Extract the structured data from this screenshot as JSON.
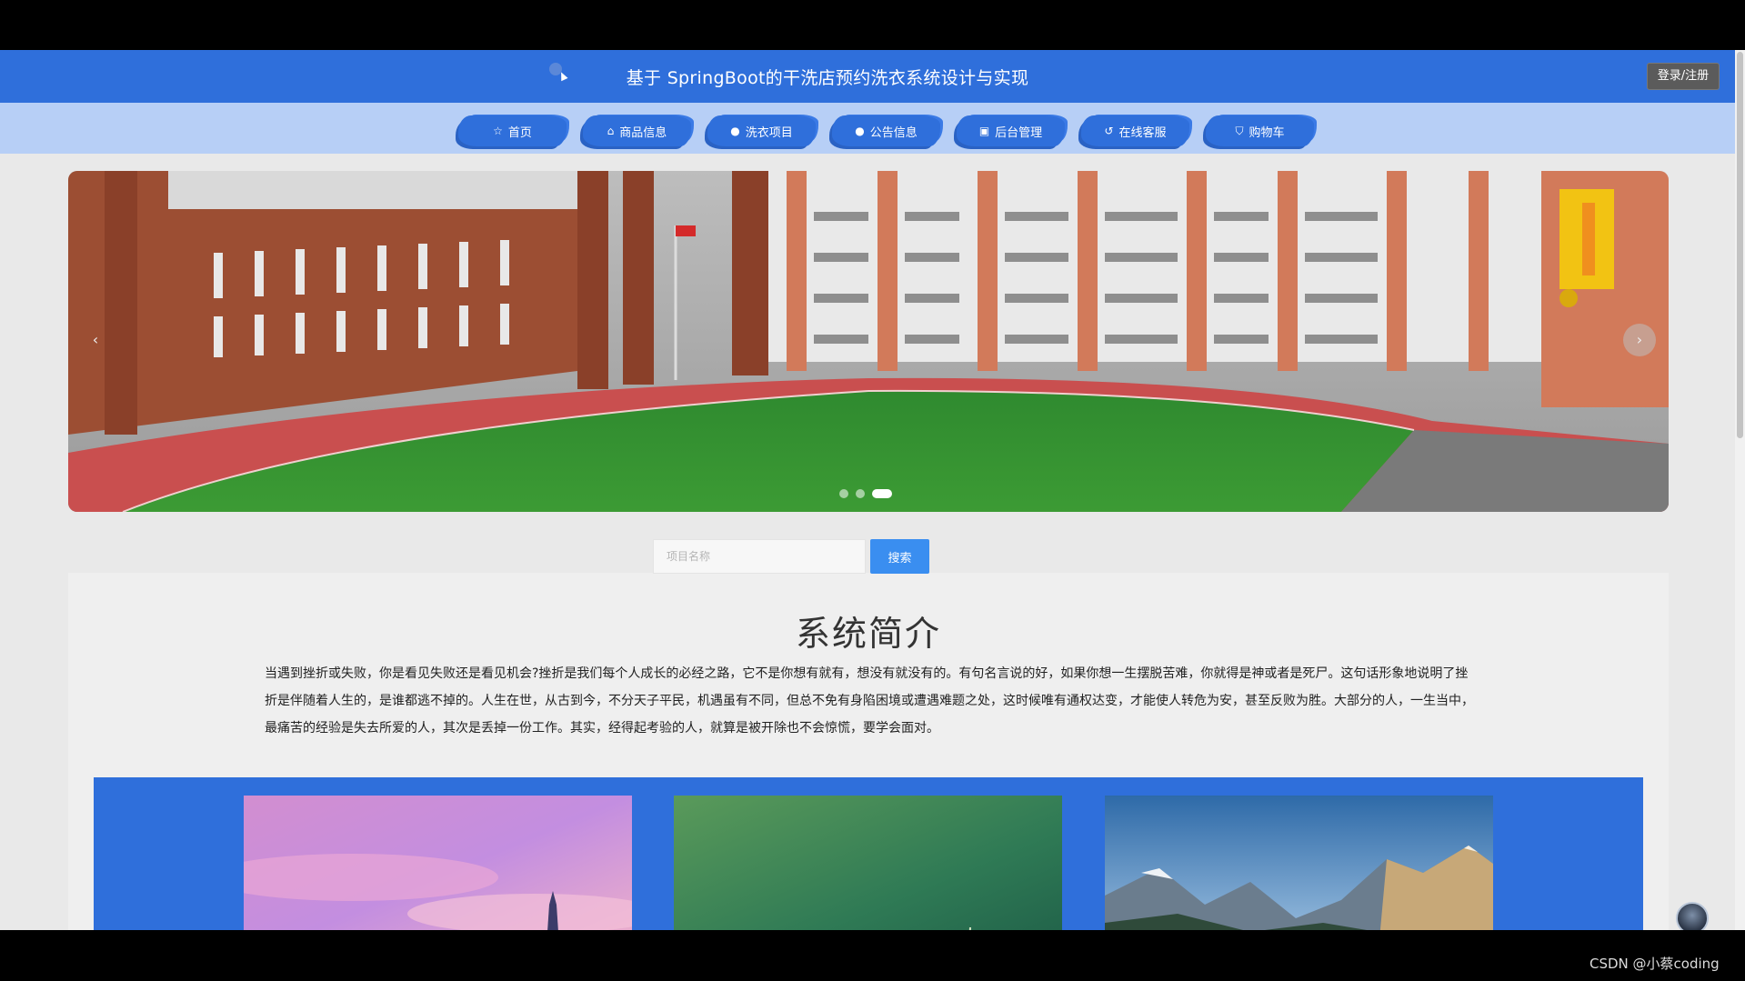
{
  "header": {
    "title": "基于 SpringBoot的干洗店预约洗衣系统设计与实现",
    "login_label": "登录/注册"
  },
  "nav": {
    "items": [
      {
        "label": "首页",
        "icon": "star-icon",
        "glyph": "☆"
      },
      {
        "label": "商品信息",
        "icon": "bag-icon",
        "glyph": "⌂"
      },
      {
        "label": "洗衣项目",
        "icon": "info-icon",
        "glyph": "●"
      },
      {
        "label": "公告信息",
        "icon": "question-icon",
        "glyph": "●"
      },
      {
        "label": "后台管理",
        "icon": "dashboard-icon",
        "glyph": "▣"
      },
      {
        "label": "在线客服",
        "icon": "headset-icon",
        "glyph": "↺"
      },
      {
        "label": "购物车",
        "icon": "cart-icon",
        "glyph": "⛉"
      }
    ]
  },
  "banner": {
    "prev_glyph": "‹",
    "next_glyph": "›",
    "dot_count": 3,
    "active_index": 2
  },
  "search": {
    "placeholder": "项目名称",
    "button_label": "搜索"
  },
  "intro": {
    "title": "系统简介",
    "text": "当遇到挫折或失败，你是看见失败还是看见机会?挫折是我们每个人成长的必经之路，它不是你想有就有，想没有就没有的。有句名言说的好，如果你想一生摆脱苦难，你就得是神或者是死尸。这句话形象地说明了挫折是伴随着人生的，是谁都逃不掉的。人生在世，从古到今，不分天子平民，机遇虽有不同，但总不免有身陷困境或遭遇难题之处，这时候唯有通权达变，才能使人转危为安，甚至反败为胜。大部分的人，一生当中，最痛苦的经验是失去所爱的人，其次是丢掉一份工作。其实，经得起考验的人，就算是被开除也不会惊慌，要学会面对。"
  },
  "watermark": "CSDN @小蔡coding",
  "colors": {
    "header_blue": "#2f6fdb",
    "nav_bg": "#b7cff6",
    "search_button": "#3a8ef0",
    "page_bg": "#e9e9e9"
  }
}
